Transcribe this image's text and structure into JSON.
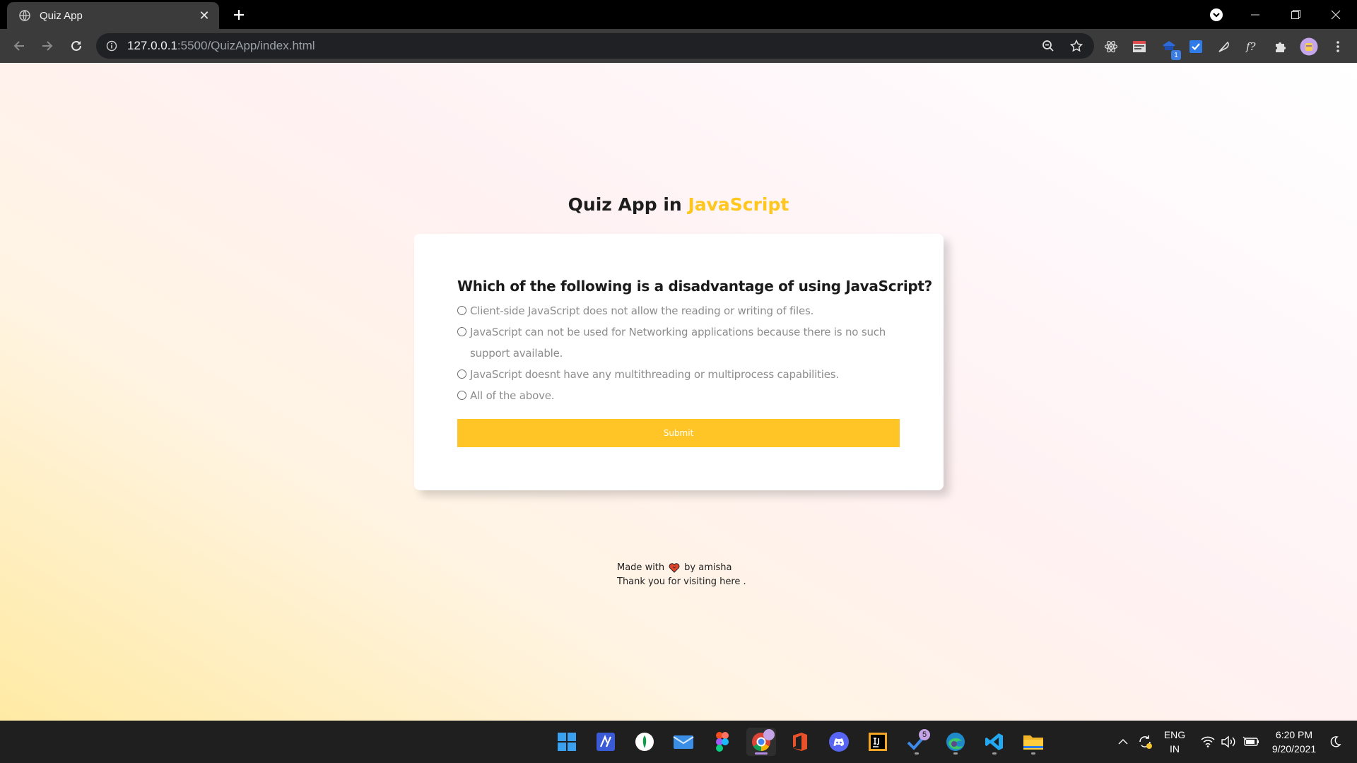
{
  "browser": {
    "tab": {
      "title": "Quiz App",
      "favicon": "globe-icon",
      "close": "✕"
    },
    "url": {
      "host": "127.0.0.1",
      "path": ":5500/QuizApp/index.html"
    },
    "window_controls": [
      "minimize-icon",
      "restore-icon",
      "close-icon"
    ],
    "extensions": [
      "react-devtools-icon",
      "json-viewer-icon",
      "extension-badge-icon",
      "todo-check-icon",
      "feather-icon",
      "font-ninja-icon",
      "puzzle-icon",
      "profile-avatar-icon",
      "more-menu-icon"
    ],
    "extension_badge_count": "1"
  },
  "page": {
    "heading": {
      "prefix": "Quiz App in ",
      "accent": "JavaScript"
    },
    "quiz": {
      "question": "Which of the following is a disadvantage of using JavaScript?",
      "options": [
        "Client-side JavaScript does not allow the reading or writing of files.",
        "JavaScript can not be used for Networking applications because there is no such support available.",
        "JavaScript doesnt have any multithreading or multiprocess capabilities.",
        "All of the above."
      ],
      "submit_label": "Submit"
    },
    "footer": {
      "made_with": "Made with",
      "by": "by amisha",
      "thanks": "Thank you for visiting here ."
    },
    "colors": {
      "accent": "#ffc61e",
      "button": "#ffc526"
    }
  },
  "taskbar": {
    "apps": [
      "start-icon",
      "editor-icon",
      "mongodb-icon",
      "mail-icon",
      "figma-icon",
      "chrome-icon",
      "office-icon",
      "discord-icon",
      "intellij-icon",
      "todo-icon",
      "edge-icon",
      "vscode-icon",
      "file-explorer-icon"
    ],
    "todo_badge": "5",
    "language": {
      "line1": "ENG",
      "line2": "IN"
    },
    "time": "6:20 PM",
    "date": "9/20/2021"
  }
}
